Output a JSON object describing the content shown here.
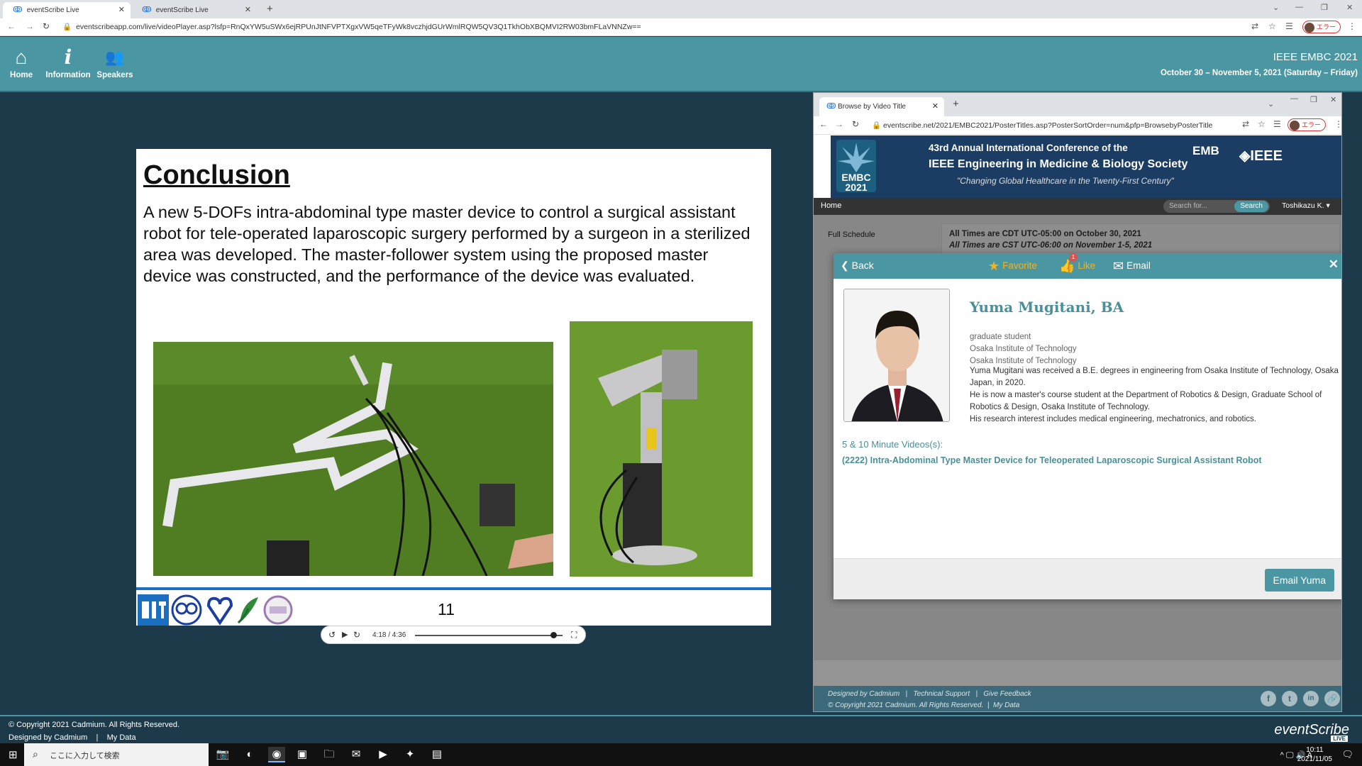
{
  "browser": {
    "tabs": [
      {
        "label": "eventScribe Live",
        "active": true
      },
      {
        "label": "eventScribe Live",
        "active": false
      }
    ],
    "url": "eventscribeapp.com/live/videoPlayer.asp?lsfp=RnQxYW5uSWx6ejRPUnJtNFVPTXgxVW5qeTFyWk8vczhjdGUrWmlRQW5QV3Q1TkhObXBQMVI2RW03bmFLaVNNZw==",
    "profile_label": "エラー"
  },
  "header": {
    "nav": [
      {
        "label": "Home",
        "icon": "home-icon",
        "glyph": "⌂"
      },
      {
        "label": "Information",
        "icon": "info-icon",
        "glyph": "𝒊"
      },
      {
        "label": "Speakers",
        "icon": "speakers-icon",
        "glyph": "👥"
      }
    ],
    "conference_title": "IEEE EMBC 2021",
    "conference_dates": "October 30 – November 5, 2021 (Saturday – Friday)"
  },
  "slide": {
    "title": "Conclusion",
    "body": " A new 5-DOFs intra-abdominal type master device to control a surgical assistant robot for tele-operated laparoscopic surgery performed by a surgeon in a sterilized area was developed. The master-follower system using the proposed master device was constructed, and the performance of the device was evaluated.",
    "page_number": "11"
  },
  "video": {
    "time": "4:18 / 4:36",
    "progress": 0.94
  },
  "inner_browser": {
    "tab_label": "Browse by Video Title",
    "url": "eventscribe.net/2021/EMBC2021/PosterTitles.asp?PosterSortOrder=num&pfp=BrowsebyPosterTitle",
    "profile_label": "エラー"
  },
  "banner": {
    "logo_text": "EMBC 2021",
    "line1": "43rd Annual International Conference of the",
    "line2": "IEEE Engineering in Medicine & Biology Society",
    "line3": "\"Changing Global Healthcare in the Twenty-First Century\"",
    "emb": "EMB",
    "ieee": "◈IEEE"
  },
  "site_nav": {
    "home": "Home",
    "search_placeholder": "Search for...",
    "search_button": "Search",
    "user": "Toshikazu K. ▾"
  },
  "site_page": {
    "side_link": "Full Schedule",
    "times_line1": "All Times are CDT UTC-05:00 on October 30, 2021",
    "times_line2": "All Times are CST UTC-06:00 on November 1-5, 2021"
  },
  "site_footer": {
    "designed_by": "Designed by Cadmium",
    "technical_support": "Technical Support",
    "give_feedback": "Give Feedback",
    "copyright": "© Copyright 2021 Cadmium. All Rights Reserved.",
    "my_data": "My Data",
    "social": [
      "f",
      "t",
      "in",
      "🔗"
    ]
  },
  "modal": {
    "back": "Back",
    "favorite": "Favorite",
    "like": "Like",
    "like_count": "1",
    "email": "Email",
    "close": "✕",
    "speaker_name": "Yuma Mugitani, BA",
    "role": "graduate student",
    "org1": "Osaka Institute of Technology",
    "org2": "Osaka Institute of Technology",
    "bio": [
      "Yuma Mugitani was received a B.E. degrees in engineering from Osaka Institute of Technology, Osaka Japan, in 2020.",
      "He is now a master's course student at the Department of Robotics & Design, Graduate School of Robotics & Design, Osaka Institute of Technology.",
      "His research interest includes medical engineering, mechatronics, and robotics."
    ],
    "videos_heading": "5 & 10 Minute Videos(s):",
    "video_link": "(2222) Intra-Abdominal Type Master Device for Teleoperated Laparoscopic Surgical Assistant Robot",
    "email_button": "Email Yuma"
  },
  "footer": {
    "copyright": "© Copyright 2021 Cadmium. All Rights Reserved.",
    "designed_by": "Designed by Cadmium",
    "separator": "|",
    "my_data": "My Data",
    "logo": "eventScribe",
    "live": "LIVE"
  },
  "taskbar": {
    "search_placeholder": "ここに入力して検索",
    "time": "10:11",
    "date": "2021/11/05",
    "tray": "^ 🖵 🔊 A"
  },
  "colors": {
    "teal": "#4a97a3",
    "dark_bg": "#1d3a4a",
    "slide_blue": "#1a6fc0"
  }
}
